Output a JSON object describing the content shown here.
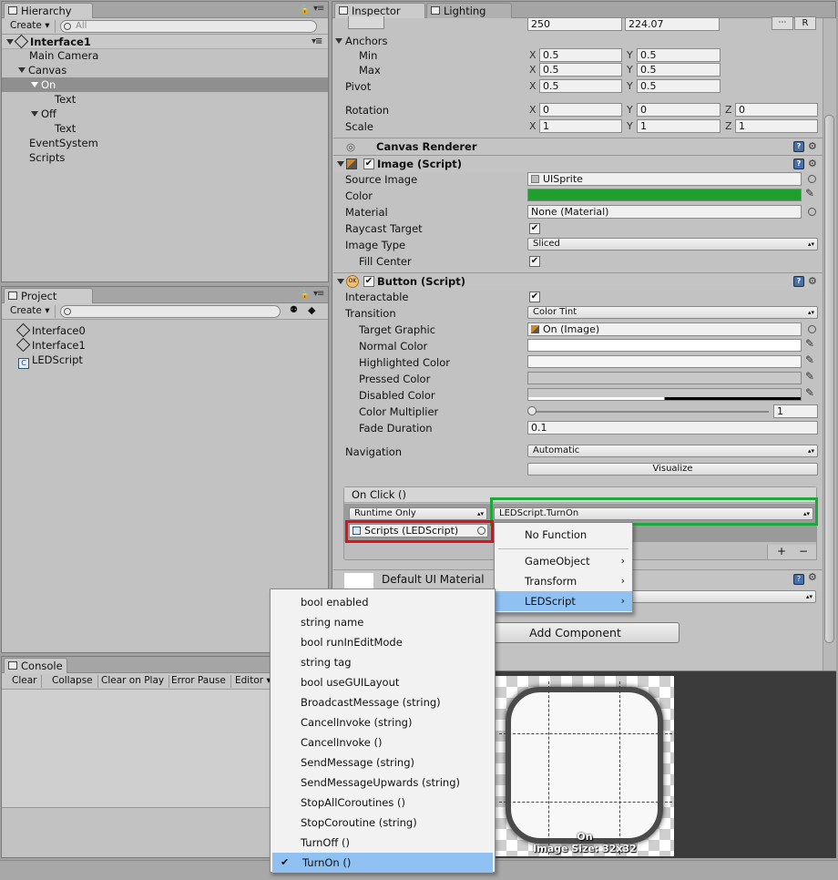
{
  "hierarchy": {
    "tab": "Hierarchy",
    "create": "Create",
    "search_placeholder": "All",
    "scene": "Interface1",
    "items": [
      "Main Camera",
      "Canvas",
      "On",
      "Text",
      "Off",
      "Text",
      "EventSystem",
      "Scripts"
    ]
  },
  "project": {
    "tab": "Project",
    "create": "Create",
    "items": [
      "Interface0",
      "Interface1",
      "LEDScript"
    ]
  },
  "console": {
    "tab": "Console",
    "buttons": [
      "Clear",
      "Collapse",
      "Clear on Play",
      "Error Pause",
      "Editor"
    ]
  },
  "inspector": {
    "tabs": [
      "Inspector",
      "Lighting"
    ],
    "top_values": [
      "250",
      "224.07"
    ],
    "r_button": "R",
    "anchors_label": "Anchors",
    "min_label": "Min",
    "max_label": "Max",
    "pivot_label": "Pivot",
    "rotation_label": "Rotation",
    "scale_label": "Scale",
    "axes": [
      "X",
      "Y",
      "Z"
    ],
    "min": [
      "0.5",
      "0.5"
    ],
    "max": [
      "0.5",
      "0.5"
    ],
    "pivot": [
      "0.5",
      "0.5"
    ],
    "rotation": [
      "0",
      "0",
      "0"
    ],
    "scale": [
      "1",
      "1",
      "1"
    ],
    "canvas_renderer": "Canvas Renderer",
    "image_script": {
      "title": "Image (Script)",
      "source_image_label": "Source Image",
      "source_image": "UISprite",
      "color_label": "Color",
      "color": "#1fa02e",
      "material_label": "Material",
      "material": "None (Material)",
      "raycast_label": "Raycast Target",
      "image_type_label": "Image Type",
      "image_type": "Sliced",
      "fill_center_label": "Fill Center"
    },
    "button_script": {
      "title": "Button (Script)",
      "interactable_label": "Interactable",
      "transition_label": "Transition",
      "transition": "Color Tint",
      "target_graphic_label": "Target Graphic",
      "target_graphic": "On (Image)",
      "normal_label": "Normal Color",
      "highlighted_label": "Highlighted Color",
      "pressed_label": "Pressed Color",
      "disabled_label": "Disabled Color",
      "multiplier_label": "Color Multiplier",
      "multiplier": "1",
      "fade_label": "Fade Duration",
      "fade": "0.1",
      "navigation_label": "Navigation",
      "navigation": "Automatic",
      "visualize": "Visualize",
      "onclick_label": "On Click ()",
      "runtime": "Runtime Only",
      "function": "LEDScript.TurnOn",
      "object": "Scripts (LEDScript)",
      "plus": "+",
      "minus": "−"
    },
    "default_material": "Default UI Material",
    "add_component": "Add Component"
  },
  "function_menu": {
    "items": [
      "No Function",
      "GameObject",
      "Transform",
      "LEDScript"
    ]
  },
  "method_menu": {
    "items": [
      "bool enabled",
      "string name",
      "bool runInEditMode",
      "string tag",
      "bool useGUILayout",
      "BroadcastMessage (string)",
      "CancelInvoke (string)",
      "CancelInvoke ()",
      "SendMessage (string)",
      "SendMessageUpwards (string)",
      "StopAllCoroutines ()",
      "StopCoroutine (string)",
      "TurnOff ()",
      "TurnOn ()"
    ]
  },
  "preview": {
    "name": "On",
    "size": "Image Size: 32x32"
  },
  "colors": {
    "highlight_green": "#1fa83a",
    "highlight_red": "#e0101c",
    "selection_blue": "#8fc1f3"
  }
}
